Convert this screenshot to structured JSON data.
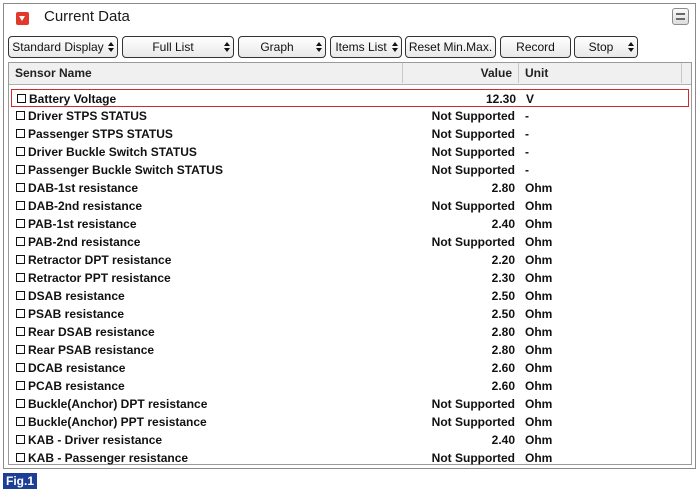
{
  "window": {
    "title": "Current Data",
    "collapse_icon": "collapse-arrow-icon",
    "menu_icon": "list-menu-icon",
    "accent_color": "#e23a2a"
  },
  "toolbar": {
    "buttons": [
      {
        "label": "Standard Display",
        "has_spinner": true
      },
      {
        "label": "Full List",
        "has_spinner": true
      },
      {
        "label": "Graph",
        "has_spinner": true
      },
      {
        "label": "Items List",
        "has_spinner": true
      },
      {
        "label": "Reset Min.Max.",
        "has_spinner": false
      },
      {
        "label": "Record",
        "has_spinner": false
      },
      {
        "label": "Stop",
        "has_spinner": true
      }
    ]
  },
  "table": {
    "columns": {
      "name": "Sensor Name",
      "value": "Value",
      "unit": "Unit"
    },
    "selected_index": 0,
    "rows": [
      {
        "name": "Battery Voltage",
        "value": "12.30",
        "unit": "V"
      },
      {
        "name": "Driver STPS STATUS",
        "value": "Not Supported",
        "unit": "-"
      },
      {
        "name": "Passenger STPS STATUS",
        "value": "Not Supported",
        "unit": "-"
      },
      {
        "name": "Driver Buckle Switch STATUS",
        "value": "Not Supported",
        "unit": "-"
      },
      {
        "name": "Passenger Buckle Switch STATUS",
        "value": "Not Supported",
        "unit": "-"
      },
      {
        "name": "DAB-1st resistance",
        "value": "2.80",
        "unit": "Ohm"
      },
      {
        "name": "DAB-2nd resistance",
        "value": "Not Supported",
        "unit": "Ohm"
      },
      {
        "name": "PAB-1st resistance",
        "value": "2.40",
        "unit": "Ohm"
      },
      {
        "name": "PAB-2nd resistance",
        "value": "Not Supported",
        "unit": "Ohm"
      },
      {
        "name": "Retractor DPT resistance",
        "value": "2.20",
        "unit": "Ohm"
      },
      {
        "name": "Retractor PPT resistance",
        "value": "2.30",
        "unit": "Ohm"
      },
      {
        "name": "DSAB resistance",
        "value": "2.50",
        "unit": "Ohm"
      },
      {
        "name": "PSAB resistance",
        "value": "2.50",
        "unit": "Ohm"
      },
      {
        "name": "Rear DSAB resistance",
        "value": "2.80",
        "unit": "Ohm"
      },
      {
        "name": "Rear PSAB resistance",
        "value": "2.80",
        "unit": "Ohm"
      },
      {
        "name": "DCAB resistance",
        "value": "2.60",
        "unit": "Ohm"
      },
      {
        "name": "PCAB resistance",
        "value": "2.60",
        "unit": "Ohm"
      },
      {
        "name": "Buckle(Anchor) DPT resistance",
        "value": "Not Supported",
        "unit": "Ohm"
      },
      {
        "name": "Buckle(Anchor) PPT resistance",
        "value": "Not Supported",
        "unit": "Ohm"
      },
      {
        "name": "KAB - Driver resistance",
        "value": "2.40",
        "unit": "Ohm"
      },
      {
        "name": "KAB - Passenger resistance",
        "value": "Not Supported",
        "unit": "Ohm"
      }
    ]
  },
  "figure_label": "Fig.1"
}
